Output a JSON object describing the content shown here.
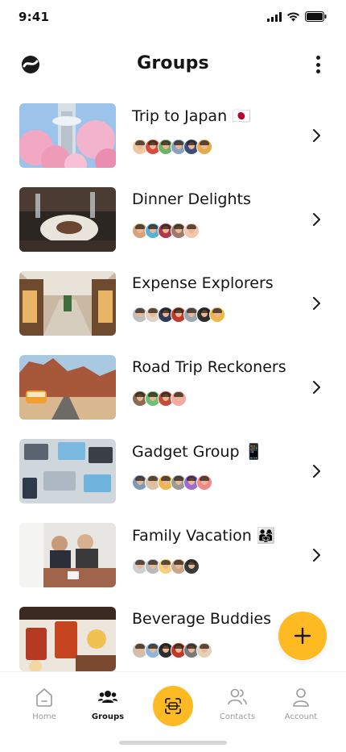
{
  "status_bar": {
    "time": "9:41"
  },
  "header": {
    "title": "Groups"
  },
  "groups": [
    {
      "name": "Trip to Japan 🇯🇵",
      "members": [
        "#f2c7a0",
        "#d94a3a",
        "#6fb36a",
        "#8aa1c4",
        "#3e4e7a",
        "#e7a94b"
      ]
    },
    {
      "name": "Dinner Delights",
      "members": [
        "#d9a27a",
        "#5ab0d6",
        "#b03a4a",
        "#9e7a6a",
        "#f4c6b0"
      ]
    },
    {
      "name": "Expense Explorers",
      "members": [
        "#bfbfbf",
        "#e0d0c0",
        "#2e3a5a",
        "#c0392b",
        "#9aa7b3",
        "#2d2d2d",
        "#f0b64a"
      ]
    },
    {
      "name": "Road Trip Reckoners",
      "members": [
        "#8a6a52",
        "#6fbf73",
        "#c44a3a",
        "#f4a9a0"
      ]
    },
    {
      "name": "Gadget Group 📱",
      "members": [
        "#7f9ab8",
        "#d9c3a8",
        "#f0b64a",
        "#9a9a9a",
        "#a06ad0",
        "#f08a8a"
      ]
    },
    {
      "name": "Family Vacation 👨‍👩‍👧",
      "members": [
        "#cfcfcf",
        "#b9b9b9",
        "#f6d07a",
        "#c9a58a",
        "#3a3a3a"
      ]
    },
    {
      "name": "Beverage Buddies",
      "members": [
        "#d0c0b0",
        "#8bb4e0",
        "#2e2e2e",
        "#c0392b",
        "#7a7a7a",
        "#e3d1b8"
      ]
    }
  ],
  "tabs": [
    {
      "label": "Home",
      "icon": "home-icon"
    },
    {
      "label": "Groups",
      "icon": "groups-icon",
      "active": true
    },
    {
      "label": "Scan",
      "icon": "scan-icon"
    },
    {
      "label": "Contacts",
      "icon": "contacts-icon"
    },
    {
      "label": "Account",
      "icon": "account-icon"
    }
  ],
  "colors": {
    "accent": "#FDBA22",
    "text": "#141414",
    "muted": "#9A9A9A"
  }
}
